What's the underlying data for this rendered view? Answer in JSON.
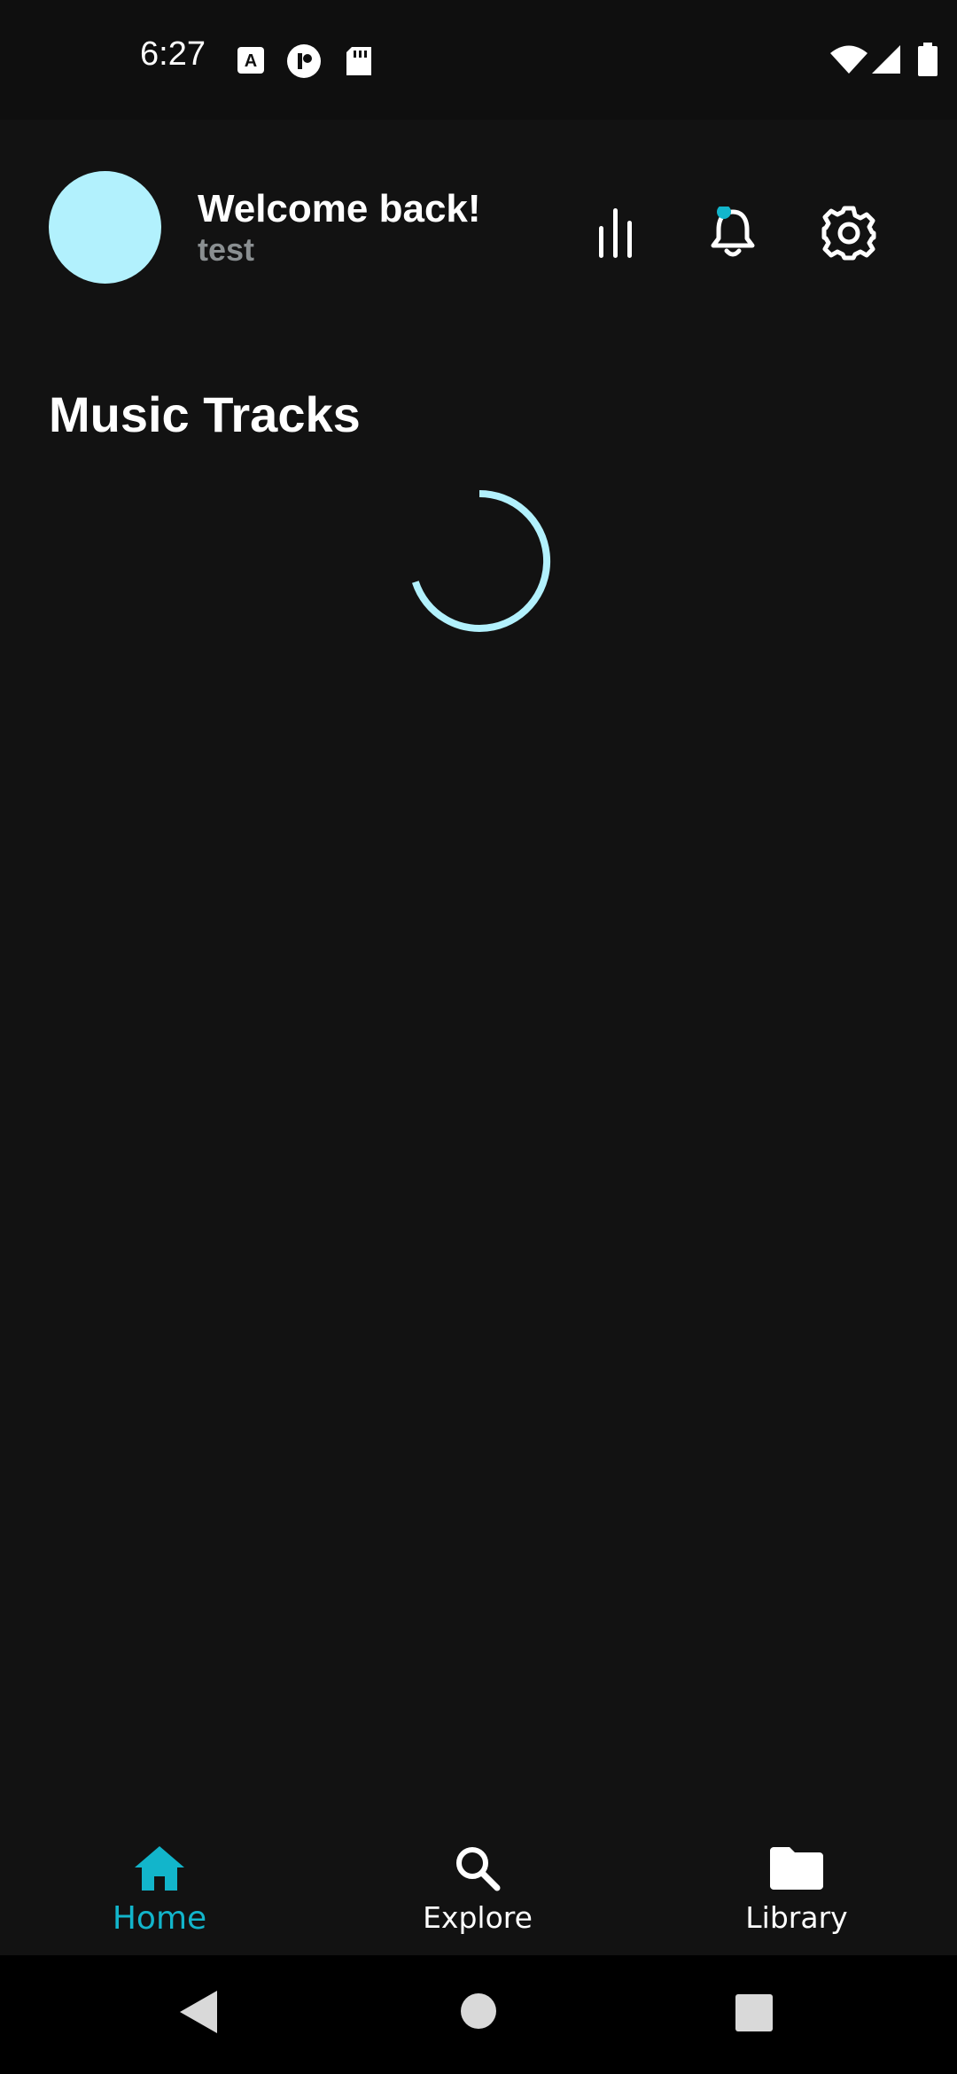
{
  "status_bar": {
    "time": "6:27",
    "icons": [
      "a-notification-icon",
      "app-notification-icon",
      "sd-card-icon",
      "wifi-icon",
      "cell-signal-icon",
      "battery-icon"
    ]
  },
  "header": {
    "welcome": "Welcome back!",
    "username": "test",
    "avatar_color": "#b2f1fd",
    "actions": [
      "equalizer-icon",
      "notification-bell-icon",
      "settings-gear-icon"
    ]
  },
  "main": {
    "section_title": "Music Tracks",
    "loading": true
  },
  "bottom_nav": {
    "items": [
      {
        "label": "Home",
        "icon": "home-icon",
        "active": true
      },
      {
        "label": "Explore",
        "icon": "search-icon",
        "active": false
      },
      {
        "label": "Library",
        "icon": "folder-icon",
        "active": false
      }
    ],
    "accent": "#12b5cb"
  },
  "system_nav": [
    "back-icon",
    "home-circle-icon",
    "recents-icon"
  ]
}
